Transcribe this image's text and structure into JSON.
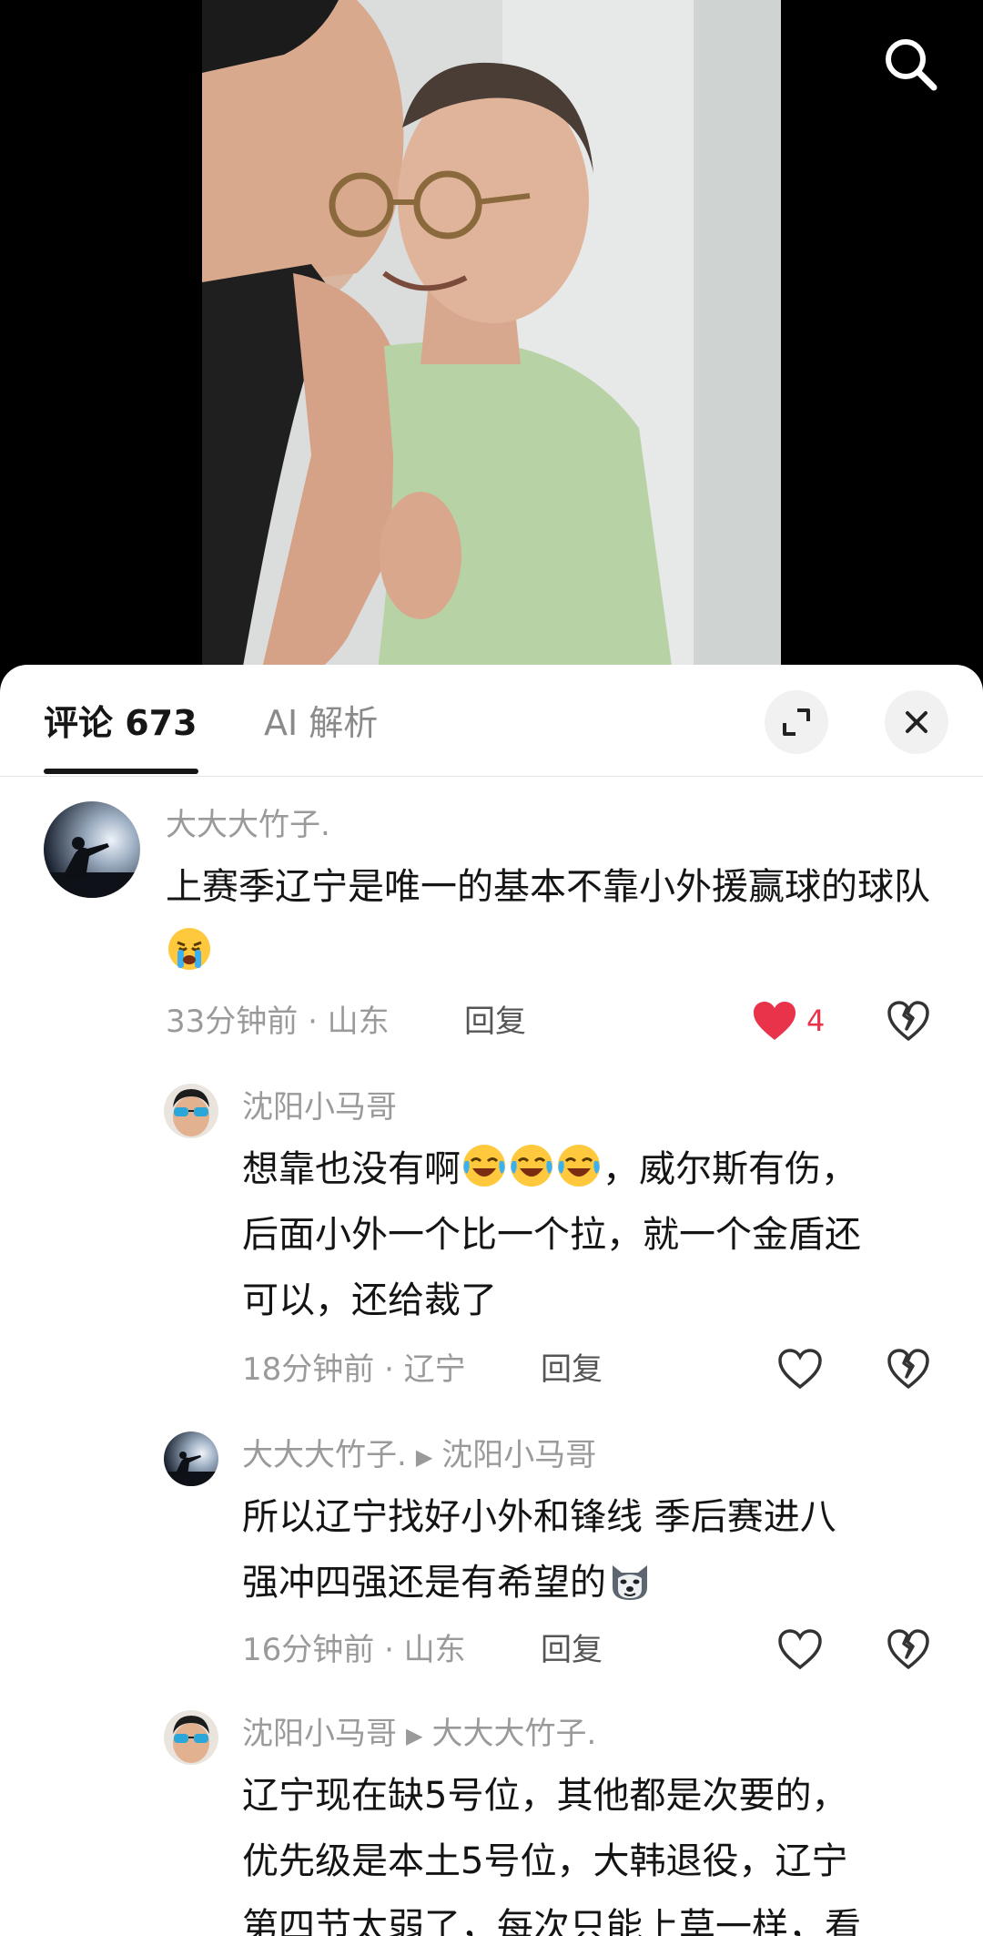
{
  "comments_tab": {
    "title": "评论 673",
    "ai_tab": "AI 解析"
  },
  "comments": [
    {
      "user": "大大大竹子.",
      "text": "上赛季辽宁是唯一的基本不靠小外援赢球的球队",
      "time": "33分钟前 · 山东",
      "reply": "回复",
      "likes": "4"
    }
  ],
  "replies": [
    {
      "user": "沈阳小马哥",
      "text_line1": "想靠也没有啊",
      "text_line1b": "，威尔斯有伤，",
      "text_line2": "后面小外一个比一个拉，就一个金盾还",
      "text_line3": "可以，还给裁了",
      "time": "18分钟前 · 辽宁",
      "reply": "回复"
    },
    {
      "user": "大大大竹子.",
      "reply_to": "沈阳小马哥",
      "text_line1": "所以辽宁找好小外和锋线 季后赛进八",
      "text_line2": "强冲四强还是有希望的",
      "time": "16分钟前 · 山东",
      "reply": "回复"
    },
    {
      "user": "沈阳小马哥",
      "reply_to": "大大大竹子.",
      "text_line1": "辽宁现在缺5号位，其他都是次要的，",
      "text_line2": "优先级是本土5号位，大韩退役，辽宁",
      "text_line3": "第四节太弱了，每次只能上草一样，看"
    }
  ],
  "icons": {
    "search": "search-icon",
    "expand": "expand-icon",
    "close": "close-icon",
    "like": "heart-icon",
    "dislike": "broken-heart-icon"
  },
  "colors": {
    "like_active": "#e8334a",
    "text_secondary": "#9a9a9a"
  }
}
